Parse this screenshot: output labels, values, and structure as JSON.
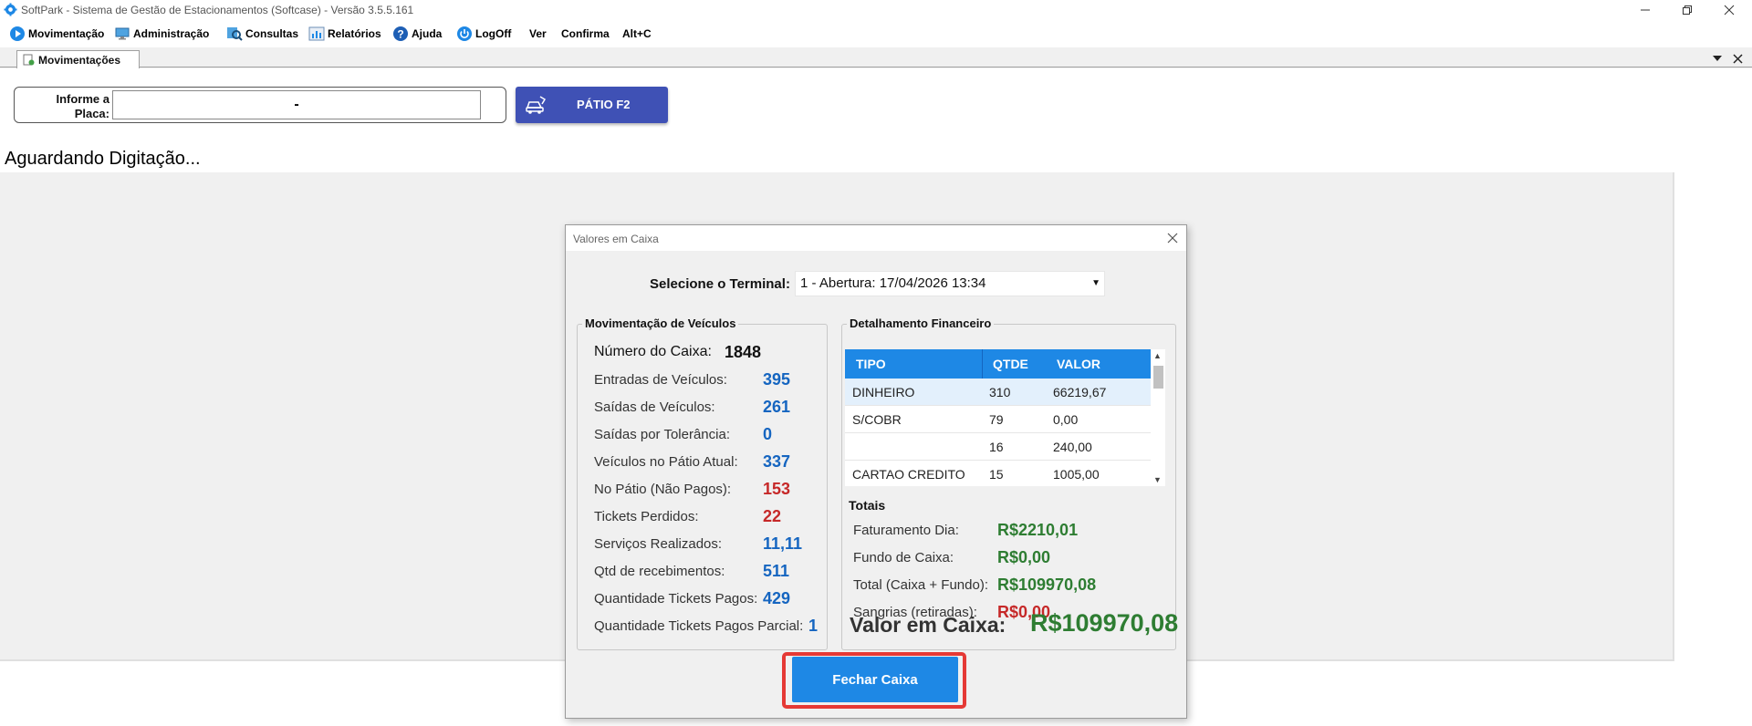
{
  "window": {
    "title": "SoftPark - Sistema de Gestão de Estacionamentos (Softcase) - Versão 3.5.5.161"
  },
  "menu": {
    "items": [
      {
        "label": "Movimentação",
        "icon": "play-icon"
      },
      {
        "label": "Administração",
        "icon": "monitor-icon"
      },
      {
        "label": "Consultas",
        "icon": "search-icon"
      },
      {
        "label": "Relatórios",
        "icon": "report-icon"
      },
      {
        "label": "Ajuda",
        "icon": "help-icon"
      },
      {
        "label": "LogOff",
        "icon": "power-icon"
      },
      {
        "label": "Ver"
      },
      {
        "label": "Confirma"
      },
      {
        "label": "Alt+C"
      }
    ]
  },
  "tab": {
    "label": "Movimentações"
  },
  "plate": {
    "label_line1": "Informe a",
    "label_line2": "Placa:",
    "value": "-"
  },
  "patio_button": {
    "label": "PÁTIO F2"
  },
  "status_text": "Aguardando Digitação...",
  "dialog": {
    "title": "Valores em Caixa",
    "terminal_label": "Selecione o Terminal:",
    "terminal_value": "1 - Abertura: 17/04/2026 13:34",
    "vehicles": {
      "title": "Movimentação de Veículos",
      "rows": [
        {
          "label": "Número do Caixa:",
          "value": "1848"
        },
        {
          "label": "Entradas de Veículos:",
          "value": "395"
        },
        {
          "label": "Saídas de Veículos:",
          "value": "261"
        },
        {
          "label": "Saídas por Tolerância:",
          "value": "0"
        },
        {
          "label": "Veículos no Pátio Atual:",
          "value": "337"
        },
        {
          "label": "No Pátio (Não Pagos):",
          "value": "153"
        },
        {
          "label": "Tickets Perdidos:",
          "value": "22"
        },
        {
          "label": "Serviços Realizados:",
          "value": "11,11"
        },
        {
          "label": "Qtd de recebimentos:",
          "value": "511"
        },
        {
          "label": "Quantidade Tickets Pagos:",
          "value": "429"
        },
        {
          "label": "Quantidade Tickets Pagos Parcial:",
          "value": "1"
        }
      ]
    },
    "financial": {
      "title": "Detalhamento Financeiro",
      "columns": [
        "TIPO",
        "QTDE",
        "VALOR"
      ],
      "rows": [
        [
          "DINHEIRO",
          "310",
          "66219,67"
        ],
        [
          "S/COBR",
          "79",
          "0,00"
        ],
        [
          "",
          "16",
          "240,00"
        ],
        [
          "CARTAO CREDITO",
          "15",
          "1005,00"
        ]
      ],
      "totals_title": "Totais",
      "totals": [
        {
          "label": "Faturamento Dia:",
          "value": "R$2210,01"
        },
        {
          "label": "Fundo de Caixa:",
          "value": "R$0,00"
        },
        {
          "label": "Total (Caixa + Fundo):",
          "value": "R$109970,08"
        },
        {
          "label": "Sangrias (retiradas):",
          "value": "R$0,00"
        }
      ],
      "caixa_label": "Valor em Caixa:",
      "caixa_value": "R$109970,08"
    },
    "close_button": "Fechar Caixa"
  },
  "colors": {
    "accent_blue": "#1e88e5",
    "patio_blue": "#3f51b5",
    "value_blue": "#1565c0",
    "value_red": "#c62828",
    "value_green": "#2e7d32",
    "highlight_red": "#e53935"
  }
}
